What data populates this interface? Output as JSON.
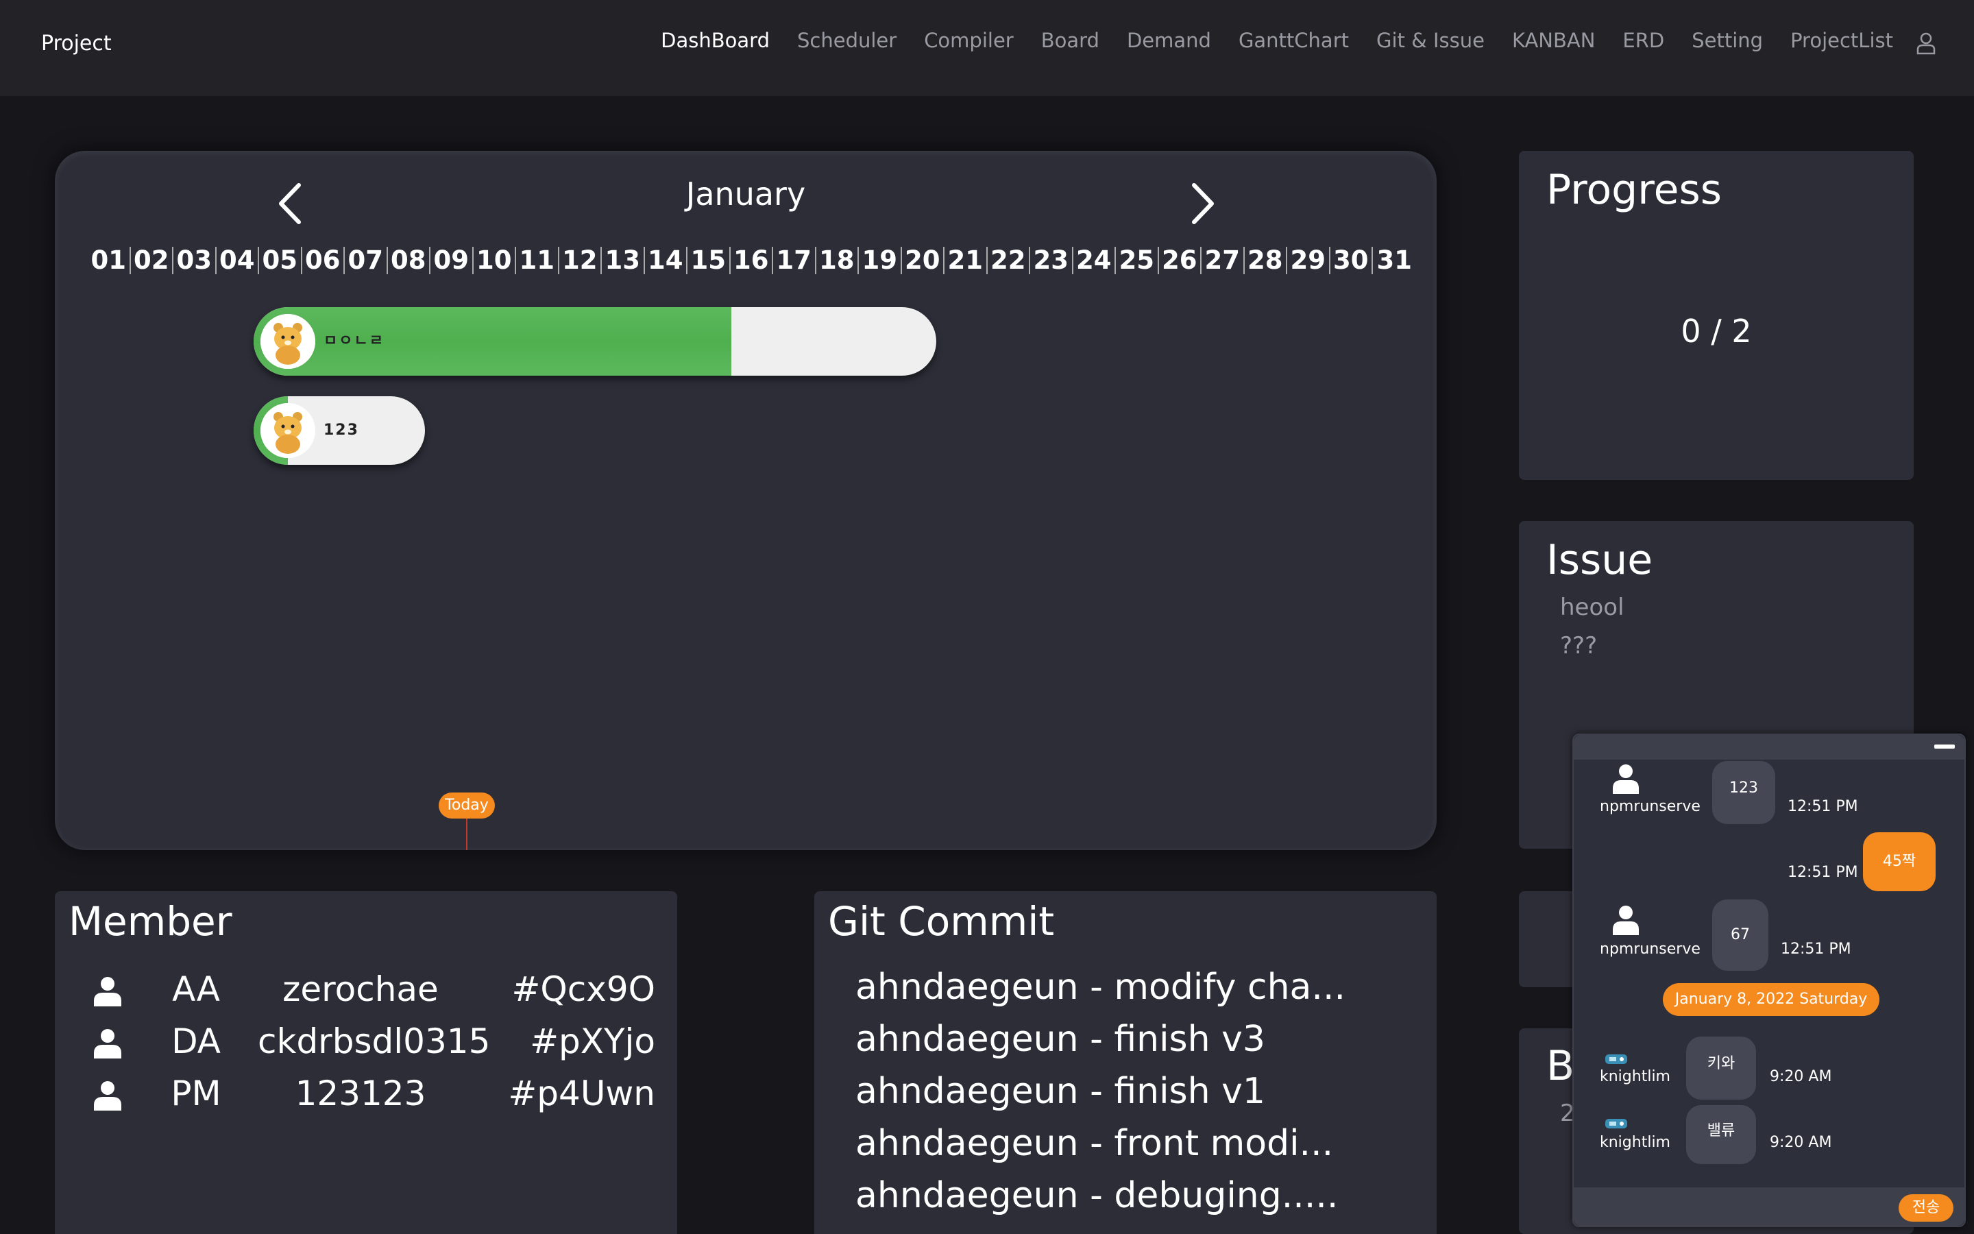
{
  "navbar": {
    "brand": "Project",
    "links": [
      "DashBoard",
      "Scheduler",
      "Compiler",
      "Board",
      "Demand",
      "GanttChart",
      "Git & Issue",
      "KANBAN",
      "ERD",
      "Setting",
      "ProjectList"
    ],
    "active": "DashBoard"
  },
  "gantt": {
    "month": "January",
    "days": [
      "01",
      "02",
      "03",
      "04",
      "05",
      "06",
      "07",
      "08",
      "09",
      "10",
      "11",
      "12",
      "13",
      "14",
      "15",
      "16",
      "17",
      "18",
      "19",
      "20",
      "21",
      "22",
      "23",
      "24",
      "25",
      "26",
      "27",
      "28",
      "29",
      "30",
      "31"
    ],
    "tasks": [
      {
        "label": "ㅁㅇㄴㄹ",
        "progress": 0.7
      },
      {
        "label": "123",
        "progress": 0.2
      }
    ],
    "today_label": "Today"
  },
  "progress": {
    "title": "Progress",
    "value": "0 / 2"
  },
  "issue": {
    "title": "Issue",
    "items": [
      "heool",
      "???"
    ]
  },
  "board": {
    "title": "B",
    "sub": "2"
  },
  "member": {
    "title": "Member",
    "rows": [
      {
        "role": "AA",
        "name": "zerochae",
        "tag": "#Qcx9O"
      },
      {
        "role": "DA",
        "name": "ckdrbsdl0315",
        "tag": "#pXYjo"
      },
      {
        "role": "PM",
        "name": "123123",
        "tag": "#p4Uwn"
      }
    ]
  },
  "git": {
    "title": "Git Commit",
    "commits": [
      "ahndaegeun - modify cha...",
      "ahndaegeun - finish v3",
      "ahndaegeun - finish v1",
      "ahndaegeun - front modi...",
      "ahndaegeun - debuging....."
    ]
  },
  "chat": {
    "messages": [
      {
        "user": "npmrunserve",
        "text": "123",
        "time": "12:51 PM",
        "mine": false
      },
      {
        "user": "",
        "text": "45짝",
        "time": "12:51 PM",
        "mine": true
      },
      {
        "user": "npmrunserve",
        "text": "67",
        "time": "12:51 PM",
        "mine": false
      },
      {
        "user": "knightlim",
        "text": "키와",
        "time": "9:20 AM",
        "mine": false
      },
      {
        "user": "knightlim",
        "text": "밸류",
        "time": "9:20 AM",
        "mine": false
      }
    ],
    "date_divider": "January 8, 2022 Saturday",
    "send_label": "전송"
  },
  "colors": {
    "accent": "#f58a1f",
    "progress_green": "#5cb85c",
    "panel": "#2c2d37",
    "background": "#16161b"
  }
}
